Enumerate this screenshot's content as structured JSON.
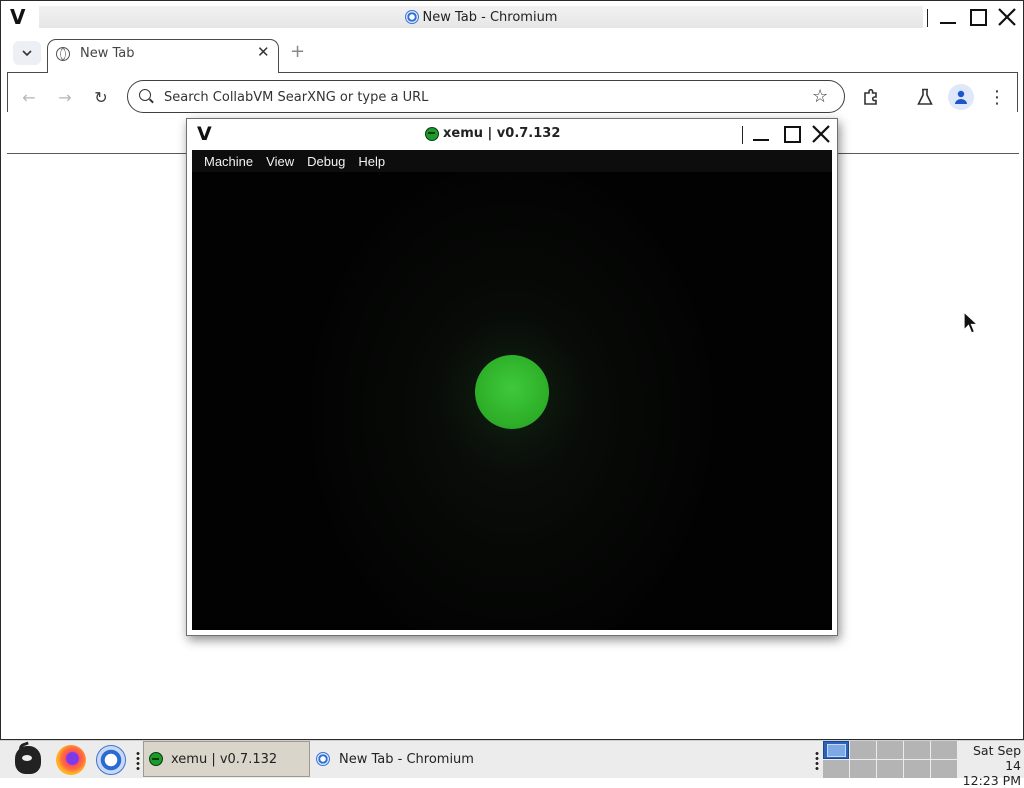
{
  "chromium_window": {
    "title": "New Tab - Chromium",
    "wm_logo": "V",
    "tabs": [
      {
        "label": "New Tab",
        "close_glyph": "✕"
      }
    ],
    "new_tab_glyph": "+",
    "tab_search_glyph": "⌄",
    "omnibox": {
      "placeholder": "Search CollabVM SearXNG or type a URL",
      "value": ""
    },
    "nav": {
      "back_glyph": "←",
      "forward_glyph": "→",
      "reload_glyph": "↻"
    },
    "bookmark_glyph": "☆",
    "menu_glyph": "⋮",
    "icons": [
      "tab-search-icon",
      "globe-icon",
      "back-arrow-icon",
      "forward-arrow-icon",
      "reload-icon",
      "search-icon",
      "star-icon",
      "puzzle-icon",
      "flask-icon",
      "profile-icon",
      "kebab-menu-icon"
    ]
  },
  "xemu_window": {
    "title": "xemu | v0.7.132",
    "wm_logo": "V",
    "menu": [
      "Machine",
      "View",
      "Debug",
      "Help"
    ],
    "screen": {
      "boot_orb_color": "#33bb2f",
      "background": "#040404"
    }
  },
  "window_controls": {
    "minimize": "minimize",
    "maximize": "maximize",
    "close": "✕"
  },
  "taskbar": {
    "tasks": [
      {
        "label": "xemu | v0.7.132",
        "active": true
      },
      {
        "label": "New Tab - Chromium",
        "active": false
      }
    ],
    "launchers": [
      "gnu-menu",
      "firefox",
      "chromium"
    ],
    "workspaces": 10,
    "active_workspace": 1,
    "clock": {
      "date": "Sat Sep 14",
      "time": "12:23 PM"
    }
  },
  "colors": {
    "accent_blue": "#2a62b8",
    "taskbar_bg": "#ececec",
    "xemu_green": "#33bb2f"
  }
}
